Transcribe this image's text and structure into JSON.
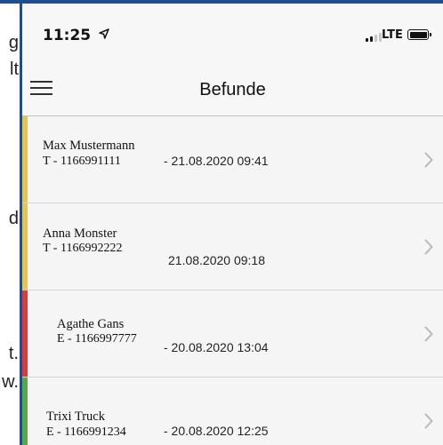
{
  "background_fragments": [
    "g",
    "lt",
    "d",
    "t.",
    "w."
  ],
  "status_bar": {
    "time": "11:25",
    "network": "LTE"
  },
  "nav": {
    "title": "Befunde"
  },
  "colors": {
    "yellow": "#e1c451",
    "red": "#d63c3c",
    "green": "#5aa64d"
  },
  "results": [
    {
      "name": "Max Mustermann",
      "id": "T - 1166991111",
      "date": "- 21.08.2020 09:41",
      "status_color": "#e1c451"
    },
    {
      "name": "Anna Monster",
      "id": "T - 1166992222",
      "date": "21.08.2020 09:18",
      "status_color": "#e1c451"
    },
    {
      "name": "Agathe Gans",
      "id": "E - 1166997777",
      "date": "- 20.08.2020 13:04",
      "status_color": "#d63c3c"
    },
    {
      "name": "Trixi Truck",
      "id": "E - 1166991234",
      "date": "- 20.08.2020 12:25",
      "status_color": "#5aa64d"
    }
  ]
}
